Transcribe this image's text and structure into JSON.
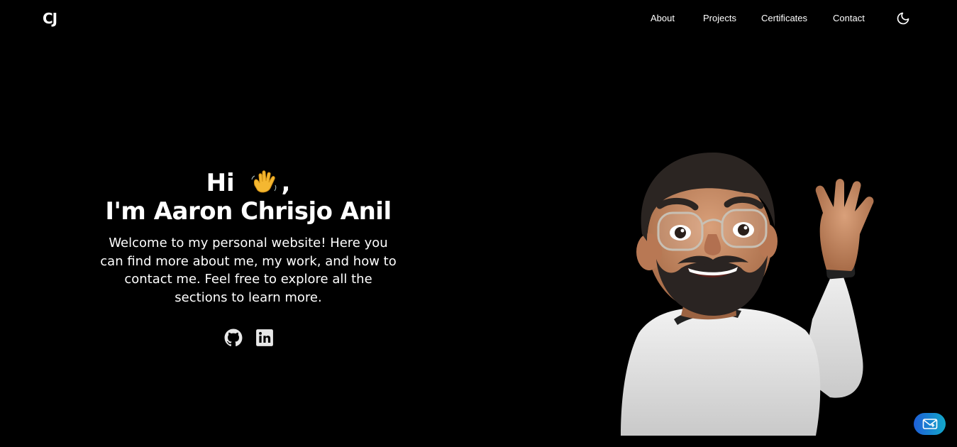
{
  "header": {
    "logo": "CJ",
    "nav": [
      {
        "label": "About"
      },
      {
        "label": "Projects"
      },
      {
        "label": "Certificates"
      },
      {
        "label": "Contact"
      }
    ],
    "theme_toggle_icon": "moon-icon"
  },
  "hero": {
    "greeting": "Hi",
    "greeting_suffix": ",",
    "wave_icon": "waving-hand-icon",
    "name": "I'm Aaron Chrisjo Anil",
    "intro": "Welcome to my personal website! Here you can find more about me, my work, and how to contact me. Feel free to explore all the sections to learn more.",
    "socials": [
      {
        "icon": "github-icon"
      },
      {
        "icon": "linkedin-icon"
      }
    ]
  },
  "avatar_icon": "memoji-avatar-waving",
  "fab_icon": "mail-icon",
  "colors": {
    "background": "#000000",
    "text": "#ffffff",
    "fab_gradient_start": "#1e5fd8",
    "fab_gradient_end": "#13a8c9",
    "social_icon": "#e8e8e8"
  }
}
